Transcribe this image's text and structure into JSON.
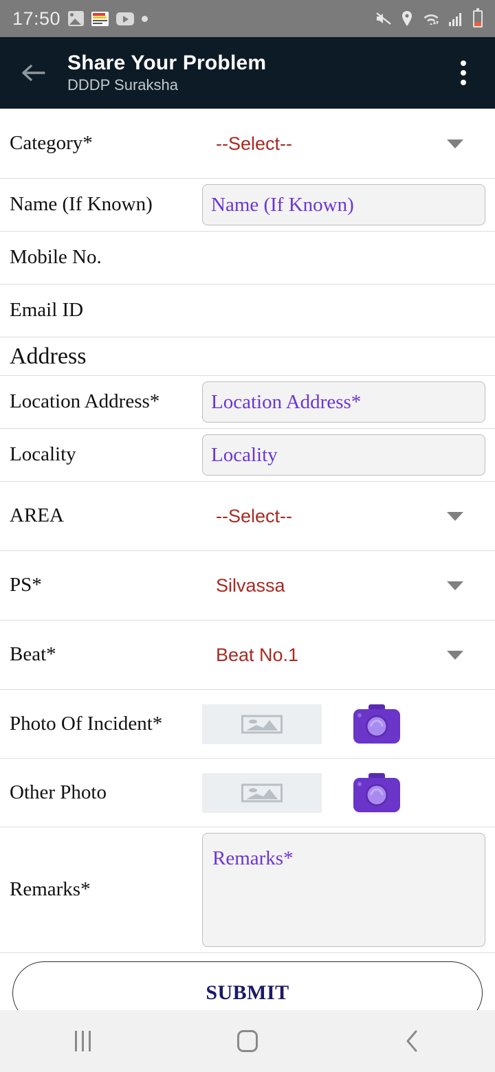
{
  "status_bar": {
    "time": "17:50",
    "left_icons": [
      "gallery-icon",
      "news-notification-icon",
      "youtube-icon",
      "dot-icon"
    ],
    "right_icons": [
      "mute-icon",
      "location-icon",
      "wifi-icon",
      "signal-icon",
      "battery-icon"
    ],
    "background": "#7b7b7b"
  },
  "app_bar": {
    "back_icon": "back-arrow-icon",
    "title": "Share Your Problem",
    "subtitle": "DDDP Suraksha",
    "menu_icon": "overflow-menu-icon",
    "background": "#0c1b26"
  },
  "colors": {
    "select_value": "#a82a22",
    "placeholder": "#6b35d6",
    "camera": "#6a35c8",
    "submit_text": "#1a1a66"
  },
  "form": {
    "rows": [
      {
        "label": "Category*",
        "type": "select",
        "value": "--Select--"
      },
      {
        "label": "Name (If Known)",
        "type": "text",
        "placeholder": "Name (If Known)"
      },
      {
        "label": "Mobile No.",
        "type": "empty"
      },
      {
        "label": "Email ID",
        "type": "empty"
      },
      {
        "label": "Address",
        "type": "section"
      },
      {
        "label": "Location Address*",
        "type": "text",
        "placeholder": "Location Address*"
      },
      {
        "label": "Locality",
        "type": "text",
        "placeholder": "Locality"
      },
      {
        "label": "AREA",
        "type": "select",
        "value": "--Select--"
      },
      {
        "label": "PS*",
        "type": "select",
        "value": "Silvassa"
      },
      {
        "label": "Beat*",
        "type": "select",
        "value": "Beat No.1"
      },
      {
        "label": "Photo Of Incident*",
        "type": "photo"
      },
      {
        "label": "Other Photo",
        "type": "photo"
      },
      {
        "label": "Remarks*",
        "type": "textarea",
        "placeholder": "Remarks*"
      }
    ],
    "submit_label": "SUBMIT"
  },
  "nav_bar": {
    "recents": "recents-icon",
    "home": "home-icon",
    "back": "back-icon"
  }
}
